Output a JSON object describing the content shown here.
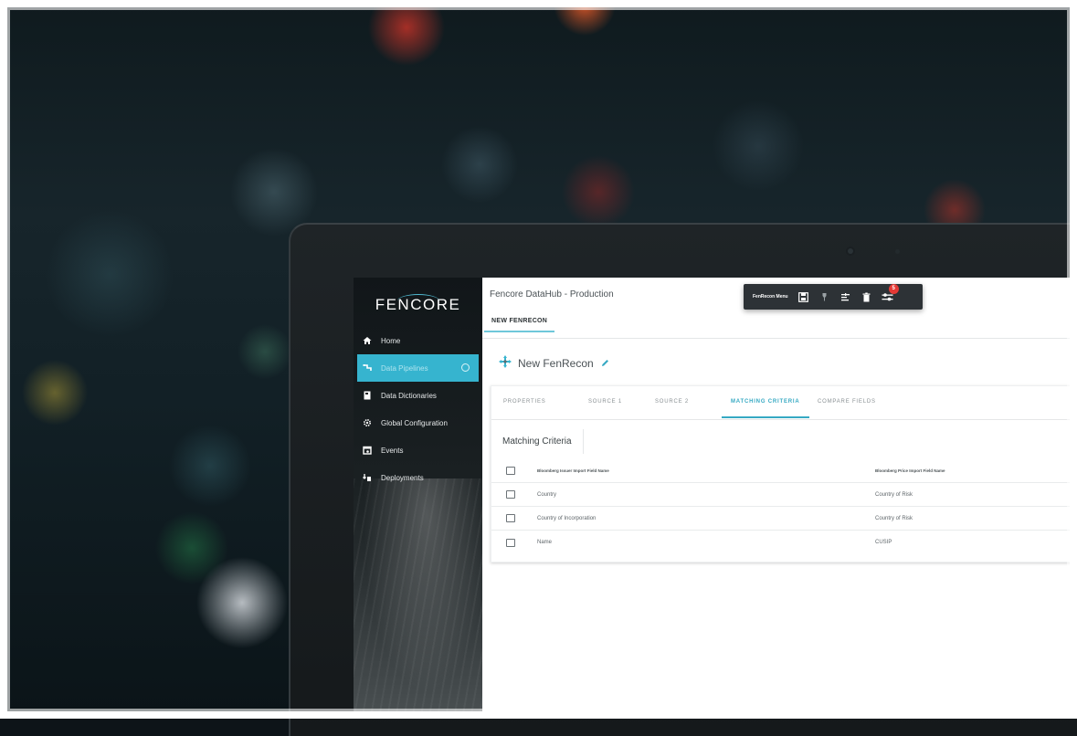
{
  "sidebar": {
    "logo_text": "FENCORE",
    "items": [
      {
        "label": "Home",
        "icon": "home-icon"
      },
      {
        "label": "Data Pipelines",
        "icon": "pipeline-icon",
        "active": true
      },
      {
        "label": "Data Dictionaries",
        "icon": "book-icon"
      },
      {
        "label": "Global Configuration",
        "icon": "gear-icon"
      },
      {
        "label": "Events",
        "icon": "calendar-icon"
      },
      {
        "label": "Deployments",
        "icon": "deploy-icon"
      }
    ]
  },
  "header": {
    "title": "Fencore DataHub - Production",
    "open_tab": "NEW FENRECON"
  },
  "toolbar": {
    "label": "FenRecon Menu",
    "badge_count": "5",
    "buttons": [
      "save-icon",
      "filter-icon",
      "sort-icon",
      "delete-icon",
      "settings-icon"
    ]
  },
  "recon": {
    "title": "New FenRecon"
  },
  "tabs": [
    {
      "label": "PROPERTIES"
    },
    {
      "label": "SOURCE 1"
    },
    {
      "label": "SOURCE 2"
    },
    {
      "label": "MATCHING CRITERIA",
      "active": true
    },
    {
      "label": "COMPARE FIELDS"
    }
  ],
  "matching": {
    "section_title": "Matching Criteria",
    "columns": [
      "Bloomberg Issuer Import Field Name",
      "Bloomberg Price Import Field Name"
    ],
    "rows": [
      [
        "Country",
        "Country of Risk"
      ],
      [
        "Country of Incorporation",
        "Country of Risk"
      ],
      [
        "Name",
        "CUSIP"
      ]
    ]
  },
  "colors": {
    "accent": "#36b4cf",
    "active_tab": "#36a9c3",
    "toolbar_bg": "#2d3236",
    "badge": "#e53935"
  }
}
